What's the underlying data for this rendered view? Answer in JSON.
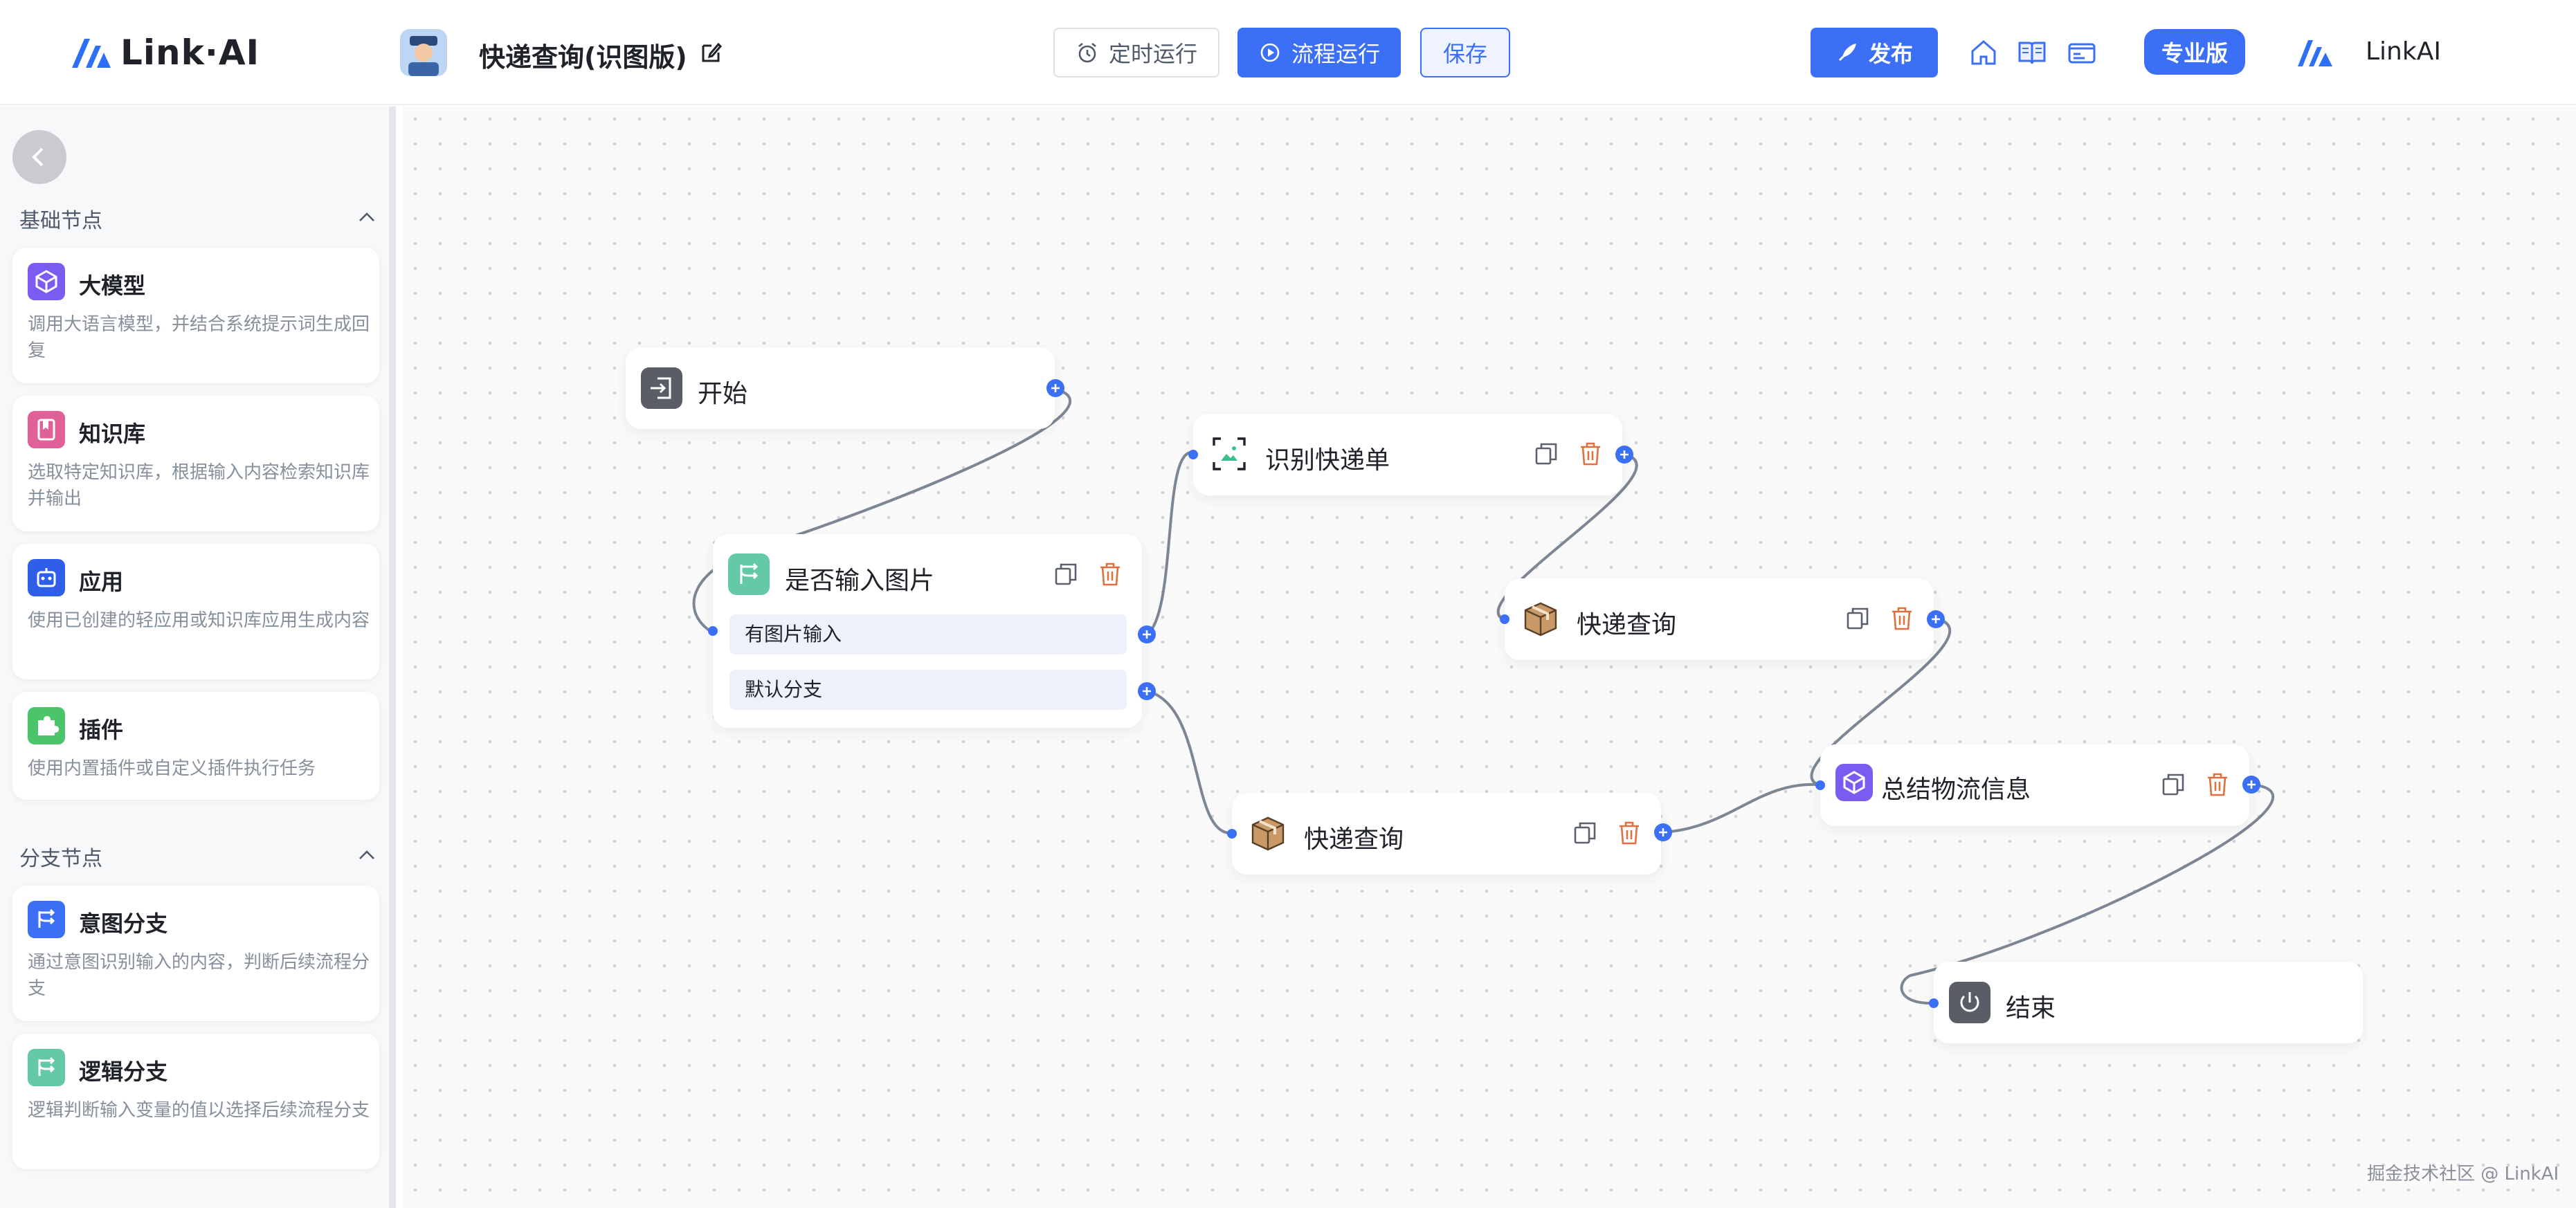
{
  "header": {
    "brand_name": "Link·AI",
    "workflow_title": "快递查询(识图版)",
    "timer_label": "定时运行",
    "run_label": "流程运行",
    "save_label": "保存",
    "publish_label": "发布",
    "pro_label": "专业版",
    "user_name": "LinkAI"
  },
  "sidebar": {
    "sections": [
      {
        "title": "基础节点"
      },
      {
        "title": "分支节点"
      }
    ],
    "cards": [
      {
        "title": "大模型",
        "desc": "调用大语言模型，并结合系统提示词生成回复",
        "icon": "llm-cube-icon",
        "color": "#7b5cf0"
      },
      {
        "title": "知识库",
        "desc": "选取特定知识库，根据输入内容检索知识库并输出",
        "icon": "book-icon",
        "color": "#e0609a"
      },
      {
        "title": "应用",
        "desc": "使用已创建的轻应用或知识库应用生成内容",
        "icon": "robot-icon",
        "color": "#2f5fe8"
      },
      {
        "title": "插件",
        "desc": "使用内置插件或自定义插件执行任务",
        "icon": "puzzle-icon",
        "color": "#4cc46a"
      },
      {
        "title": "意图分支",
        "desc": "通过意图识别输入的内容，判断后续流程分支",
        "icon": "branch-icon",
        "color": "#3b6ff5"
      },
      {
        "title": "逻辑分支",
        "desc": "逻辑判断输入变量的值以选择后续流程分支",
        "icon": "branch-icon",
        "color": "#63c9a6"
      }
    ]
  },
  "nodes": {
    "start": {
      "title": "开始"
    },
    "condition": {
      "title": "是否输入图片",
      "branch_1": "有图片输入",
      "branch_2": "默认分支"
    },
    "recognize": {
      "title": "识别快递单"
    },
    "query_1": {
      "title": "快递查询"
    },
    "query_2": {
      "title": "快递查询"
    },
    "summary": {
      "title": "总结物流信息"
    },
    "end": {
      "title": "结束"
    }
  },
  "colors": {
    "accent": "#3b6ff5",
    "delete": "#e0713f",
    "edge": "#7d8694"
  },
  "footer": {
    "watermark": "掘金技术社区 @ LinkAI"
  }
}
